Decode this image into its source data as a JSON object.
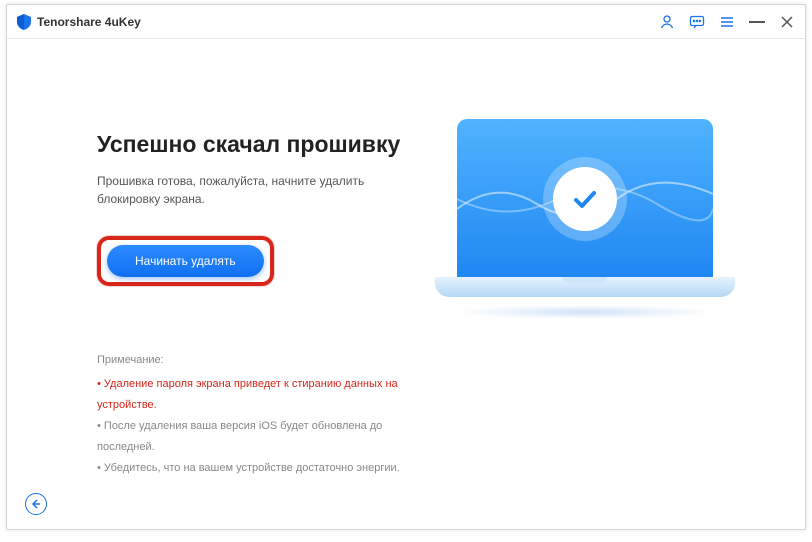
{
  "app": {
    "title": "Tenorshare 4uKey"
  },
  "main": {
    "heading": "Успешно скачал прошивку",
    "subtext": "Прошивка готова, пожалуйста, начните удалить блокировку экрана.",
    "start_button": "Начинать удалять"
  },
  "notes": {
    "title": "Примечание:",
    "items": [
      {
        "text": "• Удаление пароля экрана приведет к стиранию данных на устройстве.",
        "warning": true
      },
      {
        "text": "• После удаления ваша версия iOS будет обновлена до последней.",
        "warning": false
      },
      {
        "text": "• Убедитесь, что на вашем устройстве достаточно энергии.",
        "warning": false
      }
    ]
  }
}
